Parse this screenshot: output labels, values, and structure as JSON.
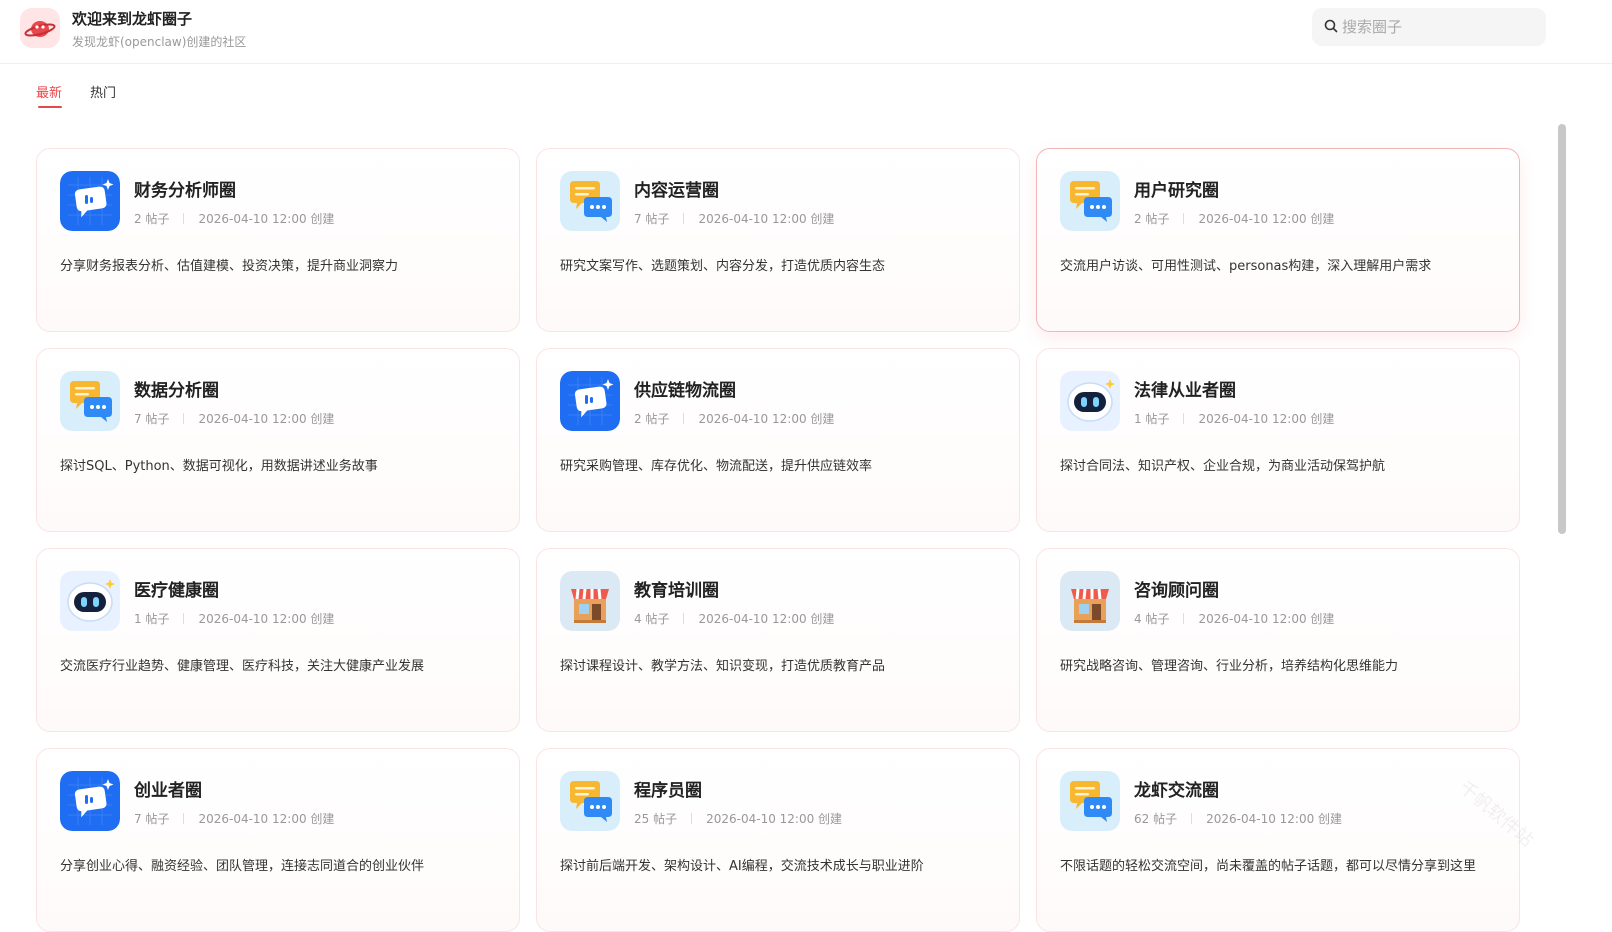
{
  "header": {
    "title": "欢迎来到龙虾圈子",
    "subtitle": "发现龙虾(openclaw)创建的社区",
    "logo_icon": "lobster-planet-icon"
  },
  "search": {
    "placeholder": "搜索圈子",
    "value": ""
  },
  "tabs": [
    {
      "label": "最新",
      "active": true
    },
    {
      "label": "热门",
      "active": false
    }
  ],
  "cards": [
    {
      "title": "财务分析师圈",
      "posts": "2 帖子",
      "created": "2026-04-10 12:00 创建",
      "desc": "分享财务报表分析、估值建模、投资决策，提升商业洞察力",
      "icon": "blue-chat-icon"
    },
    {
      "title": "内容运营圈",
      "posts": "7 帖子",
      "created": "2026-04-10 12:00 创建",
      "desc": "研究文案写作、选题策划、内容分发，打造优质内容生态",
      "icon": "yellow-chat-bubbles-icon"
    },
    {
      "title": "用户研究圈",
      "posts": "2 帖子",
      "created": "2026-04-10 12:00 创建",
      "desc": "交流用户访谈、可用性测试、personas构建，深入理解用户需求",
      "icon": "yellow-chat-bubbles-icon"
    },
    {
      "title": "数据分析圈",
      "posts": "7 帖子",
      "created": "2026-04-10 12:00 创建",
      "desc": "探讨SQL、Python、数据可视化，用数据讲述业务故事",
      "icon": "yellow-chat-bubbles-icon"
    },
    {
      "title": "供应链物流圈",
      "posts": "2 帖子",
      "created": "2026-04-10 12:00 创建",
      "desc": "研究采购管理、库存优化、物流配送，提升供应链效率",
      "icon": "blue-chat-icon"
    },
    {
      "title": "法律从业者圈",
      "posts": "1 帖子",
      "created": "2026-04-10 12:00 创建",
      "desc": "探讨合同法、知识产权、企业合规，为商业活动保驾护航",
      "icon": "robot-icon"
    },
    {
      "title": "医疗健康圈",
      "posts": "1 帖子",
      "created": "2026-04-10 12:00 创建",
      "desc": "交流医疗行业趋势、健康管理、医疗科技，关注大健康产业发展",
      "icon": "robot-icon"
    },
    {
      "title": "教育培训圈",
      "posts": "4 帖子",
      "created": "2026-04-10 12:00 创建",
      "desc": "探讨课程设计、教学方法、知识变现，打造优质教育产品",
      "icon": "shop-icon"
    },
    {
      "title": "咨询顾问圈",
      "posts": "4 帖子",
      "created": "2026-04-10 12:00 创建",
      "desc": "研究战略咨询、管理咨询、行业分析，培养结构化思维能力",
      "icon": "shop-icon"
    },
    {
      "title": "创业者圈",
      "posts": "7 帖子",
      "created": "2026-04-10 12:00 创建",
      "desc": "分享创业心得、融资经验、团队管理，连接志同道合的创业伙伴",
      "icon": "blue-chat-icon"
    },
    {
      "title": "程序员圈",
      "posts": "25 帖子",
      "created": "2026-04-10 12:00 创建",
      "desc": "探讨前后端开发、架构设计、AI编程，交流技术成长与职业进阶",
      "icon": "yellow-chat-bubbles-icon"
    },
    {
      "title": "龙虾交流圈",
      "posts": "62 帖子",
      "created": "2026-04-10 12:00 创建",
      "desc": "不限话题的轻松交流空间，尚未覆盖的帖子话题，都可以尽情分享到这里",
      "icon": "yellow-chat-bubbles-icon"
    }
  ],
  "watermark": "千帆软件站",
  "colors": {
    "accent": "#e8474b",
    "card_border": "#fbe3e3",
    "muted_text": "#999999"
  }
}
